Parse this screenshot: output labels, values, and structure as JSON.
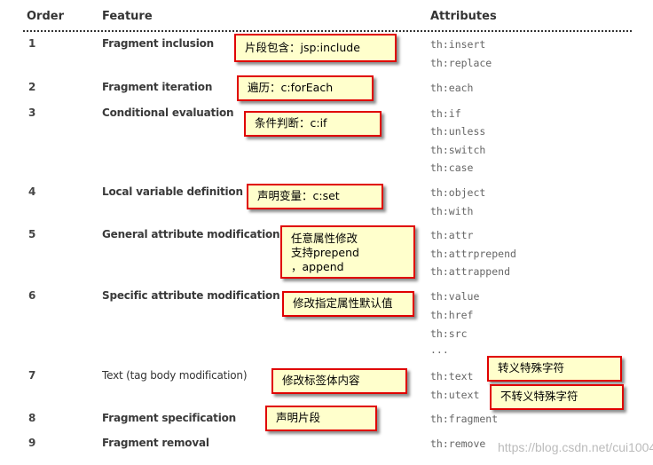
{
  "headers": {
    "order": "Order",
    "feature": "Feature",
    "attributes": "Attributes"
  },
  "rows": [
    {
      "order": "1",
      "feature": "Fragment inclusion",
      "attributes": [
        "th:insert",
        "th:replace"
      ]
    },
    {
      "order": "2",
      "feature": "Fragment iteration",
      "attributes": [
        "th:each"
      ]
    },
    {
      "order": "3",
      "feature": "Conditional evaluation",
      "attributes": [
        "th:if",
        "th:unless",
        "th:switch",
        "th:case"
      ]
    },
    {
      "order": "4",
      "feature": "Local variable definition",
      "attributes": [
        "th:object",
        "th:with"
      ]
    },
    {
      "order": "5",
      "feature": "General attribute modification",
      "attributes": [
        "th:attr",
        "th:attrprepend",
        "th:attrappend"
      ]
    },
    {
      "order": "6",
      "feature": "Specific attribute modification",
      "attributes": [
        "th:value",
        "th:href",
        "th:src",
        "..."
      ]
    },
    {
      "order": "7",
      "feature": "Text (tag body modification)",
      "attributes": [
        "th:text",
        "th:utext"
      ]
    },
    {
      "order": "8",
      "feature": "Fragment specification",
      "attributes": [
        "th:fragment"
      ]
    },
    {
      "order": "9",
      "feature": "Fragment removal",
      "attributes": [
        "th:remove"
      ]
    }
  ],
  "annotations": {
    "fragment_inclusion": "片段包含：jsp:include",
    "fragment_iteration": "遍历：c:forEach",
    "conditional_evaluation": "条件判断：c:if",
    "local_variable": "声明变量：c:set",
    "general_attribute": "任意属性修改\n支持prepend\n，append",
    "specific_attribute": "修改指定属性默认值",
    "text_modification": "修改标签体内容",
    "fragment_specification": "声明片段",
    "th_text": "转义特殊字符",
    "th_utext": "不转义特殊字符"
  },
  "colors": {
    "note_bg": "#ffffcc",
    "note_border": "#e00000"
  },
  "watermark": "https://blog.csdn.net/cui1004"
}
